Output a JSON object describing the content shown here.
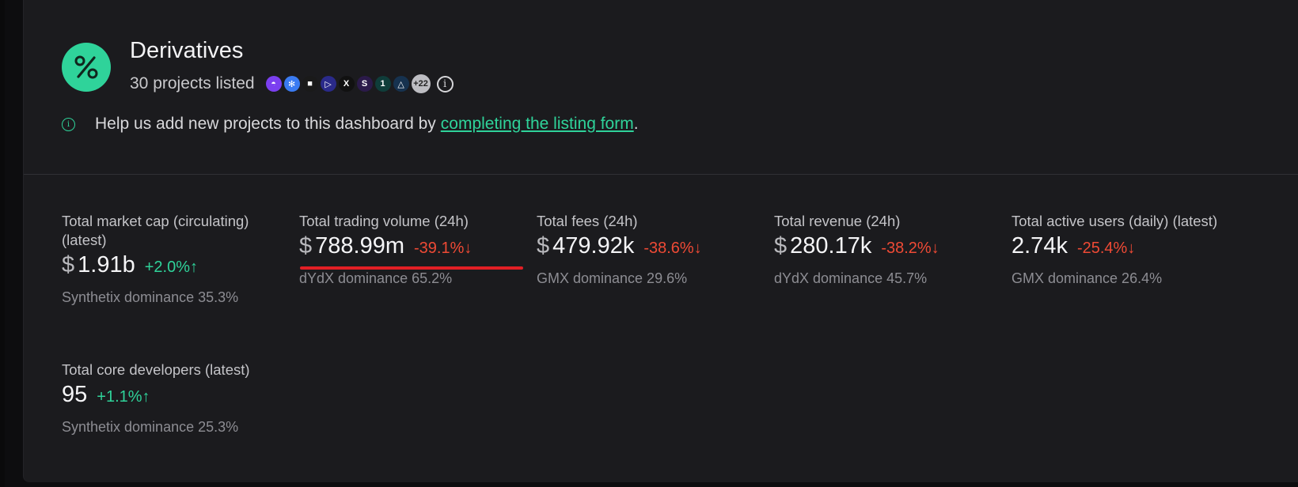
{
  "header": {
    "title": "Derivatives",
    "subtitle": "30 projects listed",
    "more_count": "+22",
    "project_logos": [
      {
        "name": "logo-1",
        "color": "#7b3ff0",
        "glyph": "◓"
      },
      {
        "name": "logo-2",
        "color": "#3a7bf2",
        "glyph": "✻"
      },
      {
        "name": "logo-3",
        "color": "#1a1a1a",
        "glyph": "■"
      },
      {
        "name": "logo-4",
        "color": "#2a2a8a",
        "glyph": "▷"
      },
      {
        "name": "logo-5",
        "color": "#111111",
        "glyph": "X"
      },
      {
        "name": "logo-6",
        "color": "#2b1a4a",
        "glyph": "S"
      },
      {
        "name": "logo-7",
        "color": "#0f3d3a",
        "glyph": "1"
      },
      {
        "name": "logo-8",
        "color": "#16324f",
        "glyph": "△"
      }
    ]
  },
  "help": {
    "text": "Help us add new projects to this dashboard by",
    "link": "completing the listing form",
    "after": "."
  },
  "metrics": [
    {
      "label": "Total market cap (circulating) (latest)",
      "currency": "$",
      "value": "1.91b",
      "change": "+2.0%↑",
      "direction": "up",
      "dominance": "Synthetix dominance 35.3%"
    },
    {
      "label": "Total trading volume (24h)",
      "currency": "$",
      "value": "788.99m",
      "change": "-39.1%↓",
      "direction": "down",
      "dominance": "dYdX dominance 65.2%"
    },
    {
      "label": "Total fees (24h)",
      "currency": "$",
      "value": "479.92k",
      "change": "-38.6%↓",
      "direction": "down",
      "dominance": "GMX dominance 29.6%"
    },
    {
      "label": "Total revenue (24h)",
      "currency": "$",
      "value": "280.17k",
      "change": "-38.2%↓",
      "direction": "down",
      "dominance": "dYdX dominance 45.7%"
    },
    {
      "label": "Total active users (daily) (latest)",
      "currency": "",
      "value": "2.74k",
      "change": "-25.4%↓",
      "direction": "down",
      "dominance": "GMX dominance 26.4%"
    },
    {
      "label": "Total core developers (latest)",
      "currency": "",
      "value": "95",
      "change": "+1.1%↑",
      "direction": "up",
      "dominance": "Synthetix dominance 25.3%"
    }
  ],
  "colors": {
    "accent": "#2fd39a",
    "negative": "#ef4a35",
    "annotation": "#e21f25"
  }
}
